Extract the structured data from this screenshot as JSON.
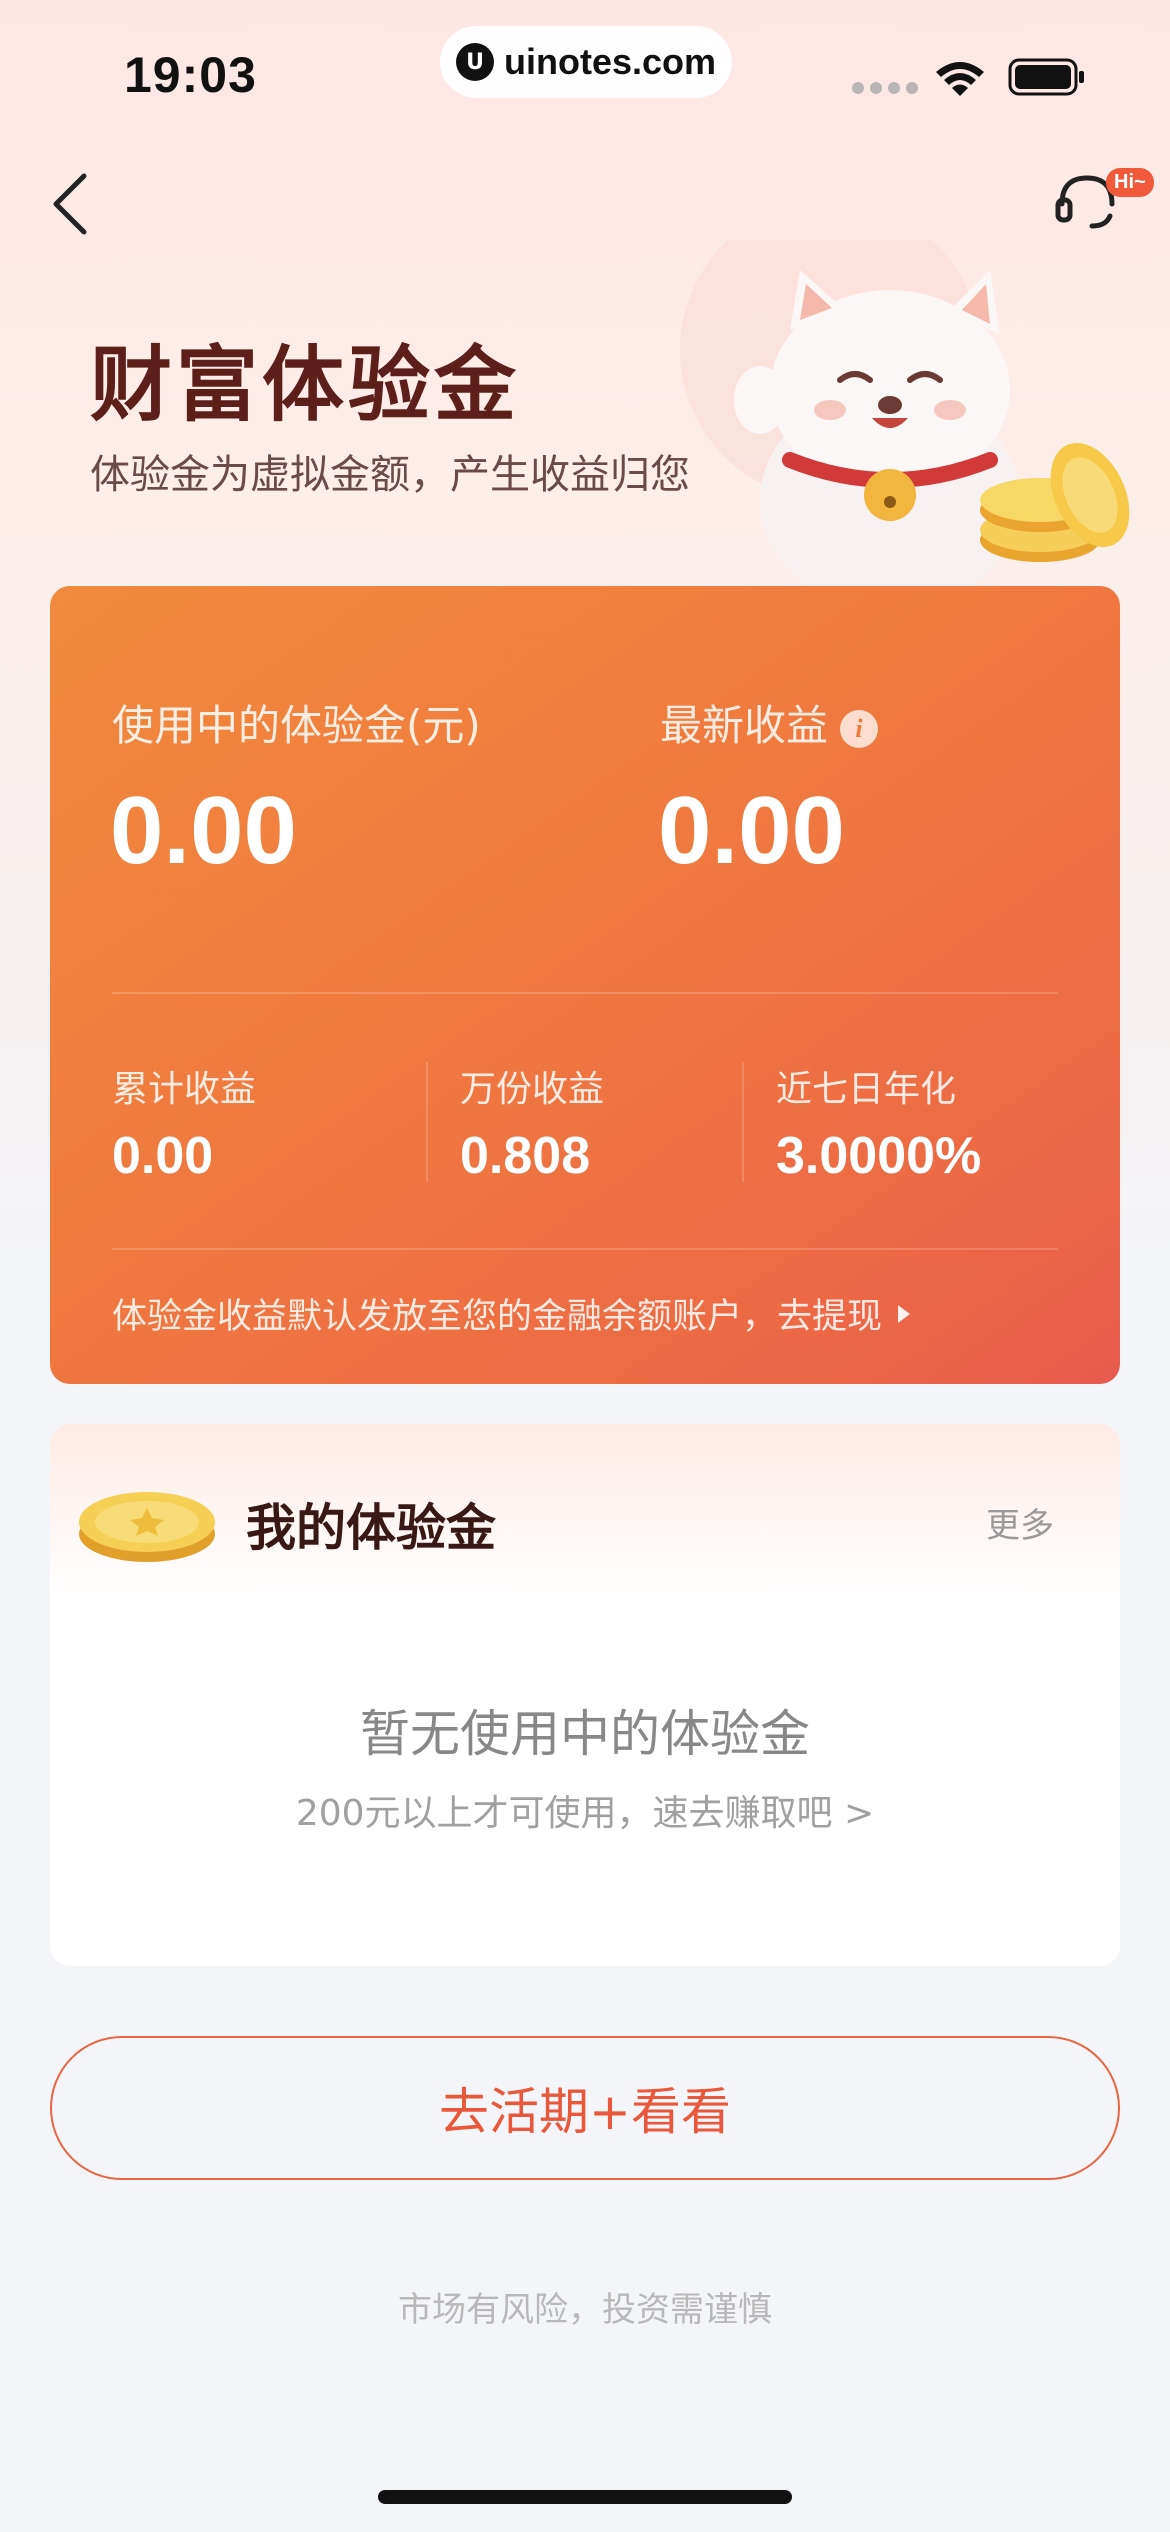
{
  "status_bar": {
    "time": "19:03",
    "url": "uinotes.com",
    "url_logo": "U"
  },
  "header": {
    "service_badge": "Hi~"
  },
  "hero": {
    "title": "财富体验金",
    "subtitle": "体验金为虚拟金额，产生收益归您"
  },
  "summary_card": {
    "in_use_label": "使用中的体验金(元)",
    "in_use_value": "0.00",
    "latest_earnings_label": "最新收益",
    "latest_earnings_value": "0.00",
    "info_icon": "i",
    "stats": [
      {
        "label": "累计收益",
        "value": "0.00"
      },
      {
        "label": "万份收益",
        "value": "0.808"
      },
      {
        "label": "近七日年化",
        "value": "3.0000%"
      }
    ],
    "footer_text": "体验金收益默认发放至您的金融余额账户，去提现"
  },
  "my_experience": {
    "title": "我的体验金",
    "more": "更多",
    "empty_title": "暂无使用中的体验金",
    "empty_hint": "200元以上才可使用，速去赚取吧 >"
  },
  "cta": {
    "label": "去活期+看看"
  },
  "risk_note": "市场有风险，投资需谨慎",
  "colors": {
    "card_start": "#f08a3c",
    "card_end": "#e95a4e",
    "accent": "#e9583b",
    "title": "#5c1f1a"
  },
  "icons": [
    "back-arrow-icon",
    "customer-service-icon",
    "info-icon",
    "coin-icon",
    "wifi-icon",
    "battery-icon",
    "mascot-cat-icon"
  ]
}
